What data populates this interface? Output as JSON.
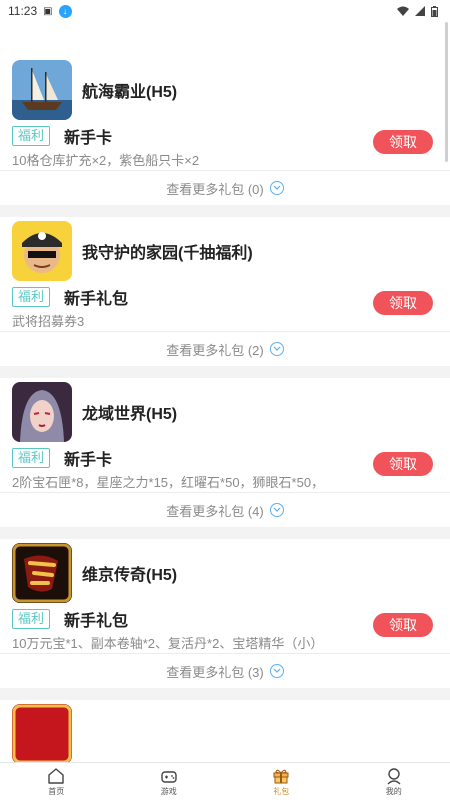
{
  "status_bar": {
    "time": "11:23"
  },
  "games": [
    {
      "name": "航海霸业(H5)",
      "tag": "福利",
      "gift_title": "新手卡",
      "gift_desc": "10格仓库扩充×2，紫色船只卡×2",
      "claim_label": "领取",
      "more_label": "查看更多礼包 (0)",
      "icon": "ship-icon"
    },
    {
      "name": "我守护的家园(千抽福利)",
      "tag": "福利",
      "gift_title": "新手礼包",
      "gift_desc": "武将招募券3",
      "claim_label": "领取",
      "more_label": "查看更多礼包 (2)",
      "icon": "pirate-icon"
    },
    {
      "name": "龙域世界(H5)",
      "tag": "福利",
      "gift_title": "新手卡",
      "gift_desc": "2阶宝石匣*8，星座之力*15，红曜石*50，狮眼石*50，",
      "claim_label": "领取",
      "more_label": "查看更多礼包 (4)",
      "icon": "warrior-icon"
    },
    {
      "name": "维京传奇(H5)",
      "tag": "福利",
      "gift_title": "新手礼包",
      "gift_desc": "10万元宝*1、副本卷轴*2、复活丹*2、宝塔精华（小）",
      "claim_label": "领取",
      "more_label": "查看更多礼包 (3)",
      "icon": "legend-icon"
    }
  ],
  "tab_bar": {
    "items": [
      {
        "label": "首页",
        "icon": "home-icon"
      },
      {
        "label": "游戏",
        "icon": "gamepad-icon"
      },
      {
        "label": "礼包",
        "icon": "gift-icon",
        "active": true
      },
      {
        "label": "我的",
        "icon": "profile-icon"
      }
    ]
  },
  "colors": {
    "accent": "#f0545a",
    "tag": "#59c7c3",
    "tab_active": "#d98a1e",
    "chevron": "#5bb0f0"
  }
}
